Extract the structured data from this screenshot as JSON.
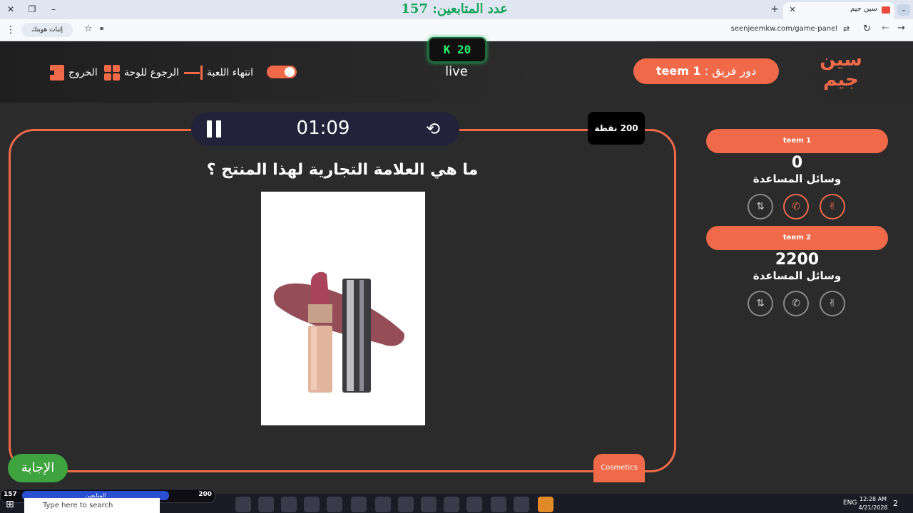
{
  "browser": {
    "banner": "عدد المتابعين: 157",
    "tab_title": "سين جيم",
    "url": "seenjeemkw.com/game-panel",
    "verify_label": "إثبات هويتك"
  },
  "header": {
    "exit_label": "الخروج",
    "board_label": "الرجوع للوحة",
    "end_label": "انتهاء اللعبة",
    "kick_badge": "K 20",
    "live": "live",
    "turn_prefix": "دور فريق :",
    "turn_team": "teem 1",
    "logo_line1": "سين",
    "logo_line2": "جيم"
  },
  "game": {
    "timer": "01:09",
    "points": "200 نقطة",
    "question": "ما هي العلامة التجارية لهذا المنتج ؟",
    "category": "Cosmetics",
    "answer_button": "الإجابة"
  },
  "teams": [
    {
      "name": "teem 1",
      "score": "0",
      "aids_label": "وسائل المساعدة"
    },
    {
      "name": "teem 2",
      "score": "2200",
      "aids_label": "وسائل المساعدة"
    }
  ],
  "taskbar": {
    "followers_left": "157",
    "followers_mid": "المتابعين",
    "followers_right": "200",
    "search_placeholder": "Type here to search",
    "lang": "ENG",
    "time": "12:28 AM",
    "date": "4/21/2026",
    "notifications": "2"
  },
  "colors": {
    "accent": "#f06a4a",
    "answer_green": "#3fa33f",
    "kick_green": "#2af06a"
  }
}
